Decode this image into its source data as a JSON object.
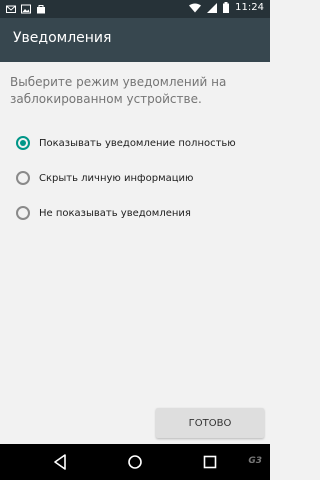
{
  "status_bar": {
    "time": "11:24",
    "icons": [
      "mail-icon",
      "image-icon",
      "bag-icon",
      "wifi-icon",
      "signal-icon",
      "battery-icon"
    ]
  },
  "app_bar": {
    "title": "Уведомления"
  },
  "main": {
    "description": "Выберите режим уведомлений на заблокированном устройстве.",
    "options": [
      {
        "label": "Показывать уведомление полностью",
        "checked": true
      },
      {
        "label": "Скрыть личную информацию",
        "checked": false
      },
      {
        "label": "Не показывать уведомления",
        "checked": false
      }
    ],
    "done_label": "ГОТОВО"
  },
  "nav_bar": {
    "icons": [
      "back-icon",
      "home-icon",
      "recents-icon"
    ],
    "watermark": "G3"
  },
  "colors": {
    "status_bar": "#263238",
    "app_bar": "#37474f",
    "accent": "#009688",
    "background": "#f2f2f2"
  }
}
